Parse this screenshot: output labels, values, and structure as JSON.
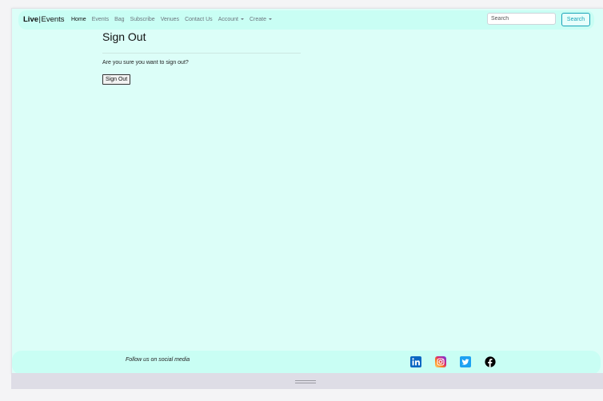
{
  "navbar": {
    "brand_bold": "Live",
    "brand_sep": "|",
    "brand_rest": "Events",
    "items": [
      {
        "label": "Home"
      },
      {
        "label": "Events"
      },
      {
        "label": "Bag"
      },
      {
        "label": "Subscribe"
      },
      {
        "label": "Venues"
      },
      {
        "label": "Contact Us"
      },
      {
        "label": "Account"
      },
      {
        "label": "Create"
      }
    ],
    "search_placeholder": "Search",
    "search_button": "Search"
  },
  "main": {
    "title": "Sign Out",
    "confirm_text": "Are you sure you want to sign out?",
    "signout_button": "Sign Out"
  },
  "footer": {
    "text": "Follow us on social media",
    "icons": [
      "linkedin-icon",
      "instagram-icon",
      "twitter-icon",
      "facebook-icon"
    ]
  },
  "colors": {
    "page_background": "#dcfef8",
    "navbar_background": "#c9fef4",
    "accent": "#17a2b8",
    "linkedin": "#0a66c2",
    "twitter": "#1da1f2",
    "facebook": "#000000"
  }
}
